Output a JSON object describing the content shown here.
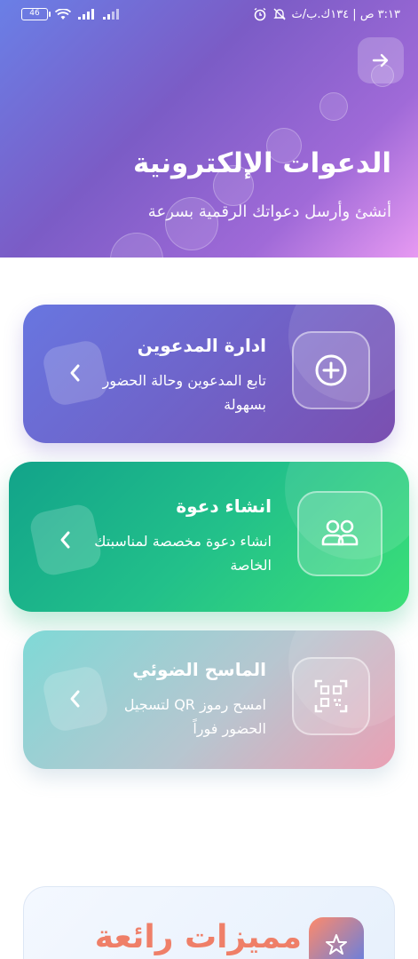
{
  "status_bar": {
    "battery": "46",
    "time": "٣:١٣ ص | ١٣٤ك.ب/ث"
  },
  "header": {
    "title": "الدعوات الإلكترونية",
    "subtitle": "أنشئ وأرسل دعواتك الرقمية بسرعة",
    "back_icon": "arrow-right-icon"
  },
  "cards": [
    {
      "title": "ادارة المدعوين",
      "description": "تابع المدعوين وحالة الحضور بسهولة",
      "icon": "plus-circle-icon",
      "color": "#6f63c9"
    },
    {
      "title": "انشاء دعوة",
      "description": "انشاء دعوة مخصصة لمناسبتك الخاصة",
      "icon": "users-icon",
      "color": "#22c08a"
    },
    {
      "title": "الماسح الضوئي",
      "description": "امسح رموز QR لتسجيل الحضور فوراً",
      "icon": "qr-code-icon",
      "color": "#b7c6d0"
    }
  ],
  "features": {
    "title": "مميزات رائعة",
    "icon": "star-icon"
  }
}
